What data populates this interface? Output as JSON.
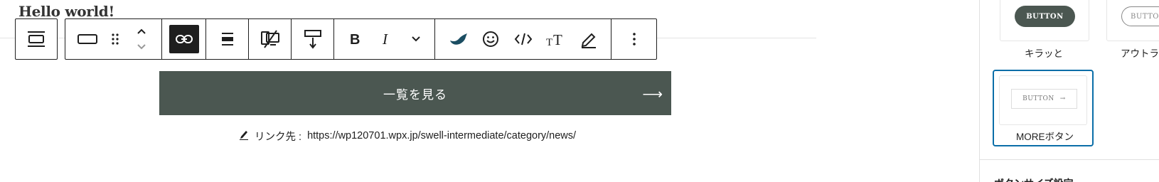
{
  "editor": {
    "post_title": "Hello world!"
  },
  "toolbar": {
    "parent": {
      "icon": "block-parent-icon"
    },
    "groups": [
      {
        "items": [
          "button-block-icon",
          "drag-handle-icon",
          "move-up-down-icon"
        ]
      },
      {
        "items": [
          "link-icon"
        ],
        "active": "link-icon"
      },
      {
        "items": [
          "justify-icon"
        ]
      },
      {
        "items": [
          "device-visibility-icon"
        ]
      },
      {
        "items": [
          "block-spacing-icon"
        ]
      },
      {
        "items": [
          "bold-icon",
          "italic-icon",
          "more-formats-icon"
        ]
      },
      {
        "items": [
          "swell-bird-icon",
          "emoji-icon",
          "code-icon",
          "font-size-icon",
          "highlight-icon"
        ]
      },
      {
        "items": [
          "options-icon"
        ]
      }
    ]
  },
  "button_block": {
    "label": "一覧を見る",
    "arrow": "⟶",
    "background": "#4b5751",
    "link_prefix": "リンク先 :",
    "link_url": "https://wp120701.wpx.jp/swell-intermediate/category/news/"
  },
  "sidebar": {
    "styles": [
      {
        "preview": "BUTTON",
        "label": "キラッと"
      },
      {
        "preview": "BUTTO",
        "label": "アウトラ"
      },
      {
        "preview": "BUTTON",
        "preview_arrow": "→",
        "label": "MOREボタン",
        "selected": true
      }
    ],
    "section_heading": "ボタンサイズ設定"
  },
  "colors": {
    "accent": "#0b6ea8",
    "button_dark": "#4b5751",
    "toolbar_border": "#1e1e1e"
  }
}
